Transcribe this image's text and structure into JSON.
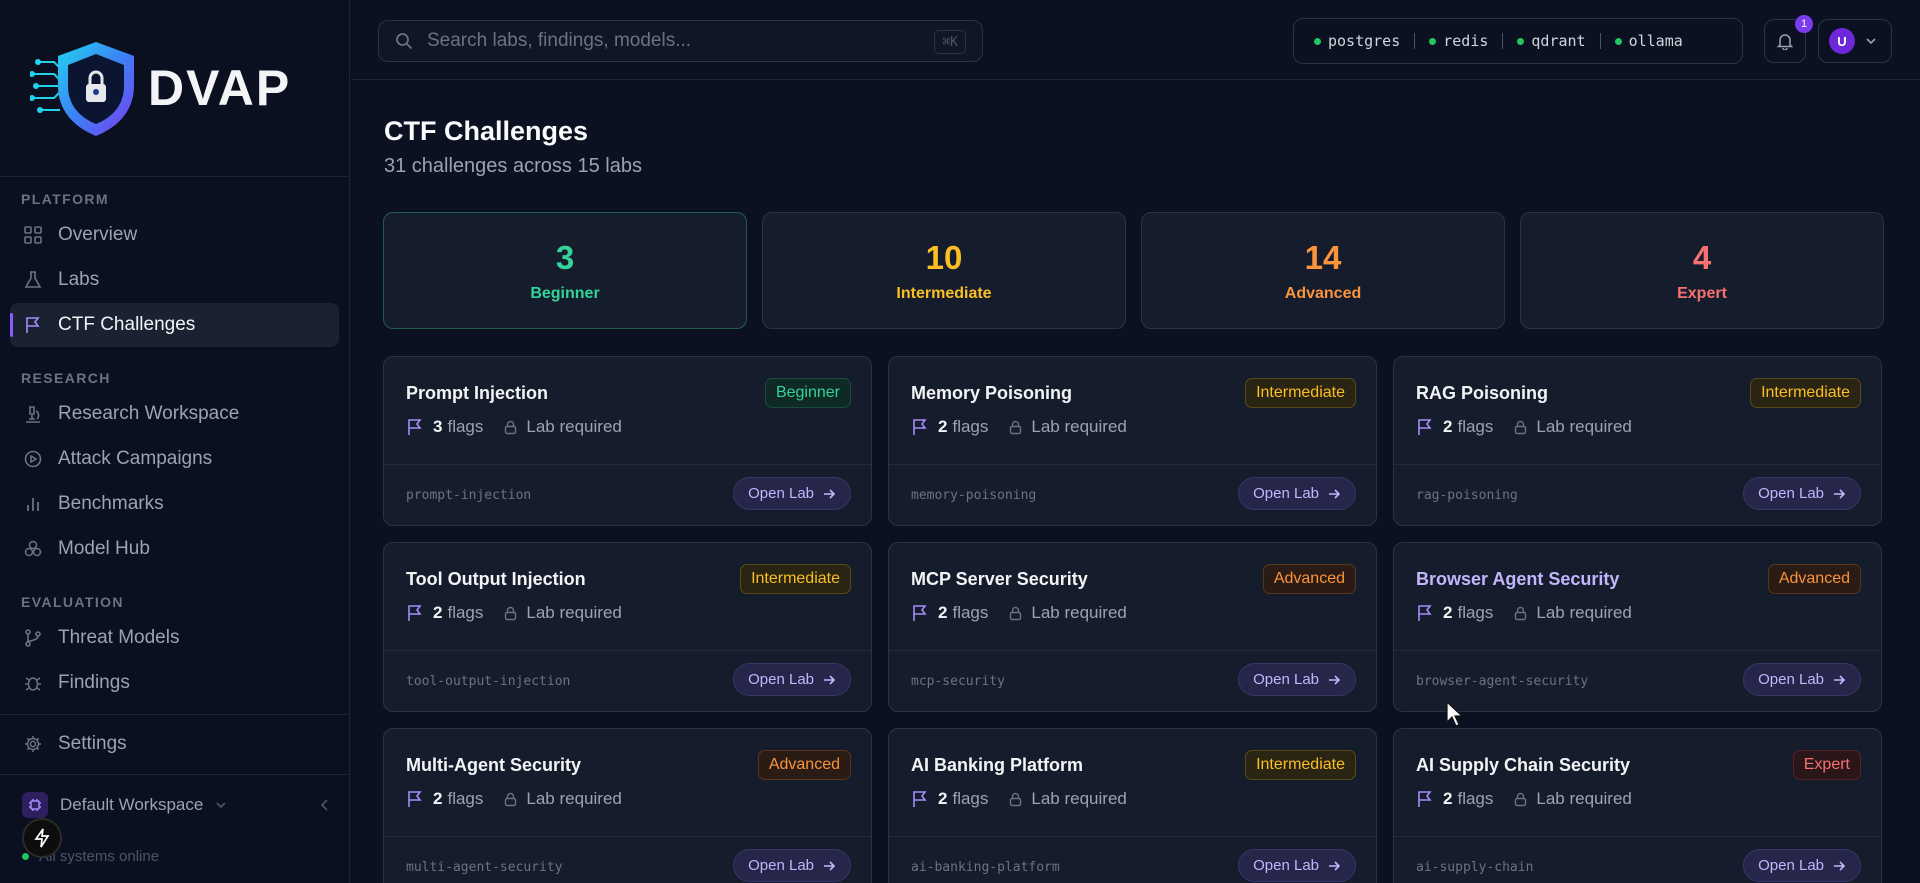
{
  "brand": {
    "name": "DVAP"
  },
  "nav": {
    "sections": [
      {
        "label": "PLATFORM",
        "items": [
          "Overview",
          "Labs",
          "CTF Challenges"
        ]
      },
      {
        "label": "RESEARCH",
        "items": [
          "Research Workspace",
          "Attack Campaigns",
          "Benchmarks",
          "Model Hub"
        ]
      },
      {
        "label": "EVALUATION",
        "items": [
          "Threat Models",
          "Findings"
        ]
      }
    ],
    "active": "CTF Challenges",
    "settings": "Settings",
    "workspace": "Default Workspace",
    "status": "All systems online"
  },
  "topbar": {
    "search_placeholder": "Search labs, findings, models...",
    "shortcut": "⌘K",
    "services": [
      "postgres",
      "redis",
      "qdrant",
      "ollama"
    ],
    "notifications": "1",
    "user_initial": "U"
  },
  "page": {
    "title": "CTF Challenges",
    "subtitle": "31 challenges across 15 labs"
  },
  "stats": [
    {
      "value": "3",
      "label": "Beginner",
      "color": "#34d399"
    },
    {
      "value": "10",
      "label": "Intermediate",
      "color": "#fbbf24"
    },
    {
      "value": "14",
      "label": "Advanced",
      "color": "#fb923c"
    },
    {
      "value": "4",
      "label": "Expert",
      "color": "#f87171"
    }
  ],
  "labels": {
    "flags": "flags",
    "lab_required": "Lab required",
    "open_lab": "Open Lab"
  },
  "challenges": [
    {
      "title": "Prompt Injection",
      "level": "Beginner",
      "flags": "3",
      "slug": "prompt-injection"
    },
    {
      "title": "Memory Poisoning",
      "level": "Intermediate",
      "flags": "2",
      "slug": "memory-poisoning"
    },
    {
      "title": "RAG Poisoning",
      "level": "Intermediate",
      "flags": "2",
      "slug": "rag-poisoning"
    },
    {
      "title": "Tool Output Injection",
      "level": "Intermediate",
      "flags": "2",
      "slug": "tool-output-injection"
    },
    {
      "title": "MCP Server Security",
      "level": "Advanced",
      "flags": "2",
      "slug": "mcp-security"
    },
    {
      "title": "Browser Agent Security",
      "level": "Advanced",
      "flags": "2",
      "slug": "browser-agent-security",
      "highlight": true
    },
    {
      "title": "Multi-Agent Security",
      "level": "Advanced",
      "flags": "2",
      "slug": "multi-agent-security"
    },
    {
      "title": "AI Banking Platform",
      "level": "Intermediate",
      "flags": "2",
      "slug": "ai-banking-platform"
    },
    {
      "title": "AI Supply Chain Security",
      "level": "Expert",
      "flags": "2",
      "slug": "ai-supply-chain"
    }
  ]
}
